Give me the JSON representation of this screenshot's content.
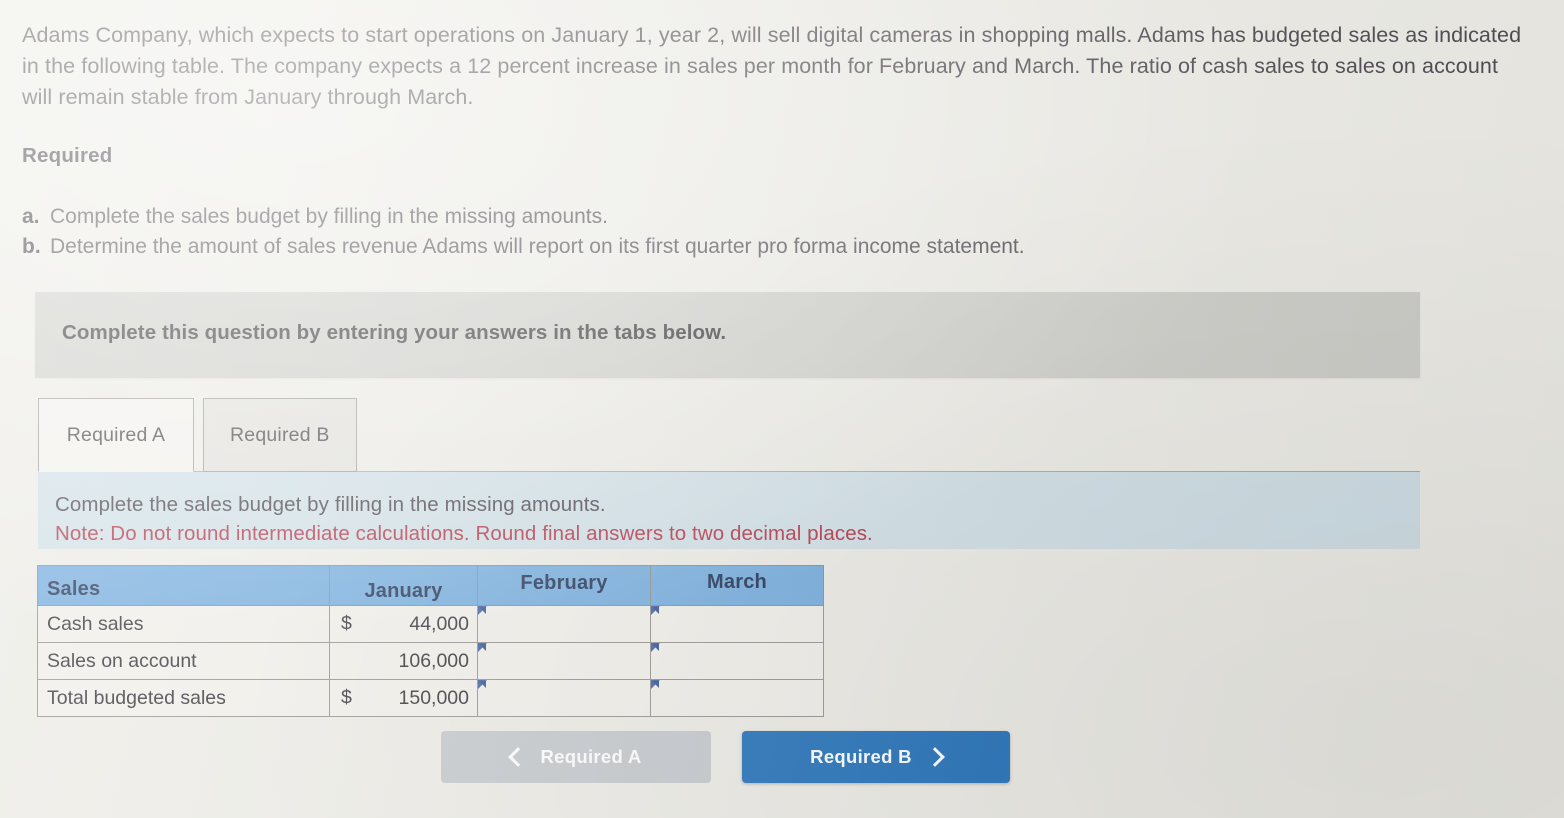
{
  "question": {
    "stem": "Adams Company, which expects to start operations on January 1, year 2, will sell digital cameras in shopping malls. Adams has budgeted sales as indicated in the following table. The company expects a 12 percent increase in sales per month for February and March. The ratio of cash sales to sales on account will remain stable from January through March.",
    "required_heading": "Required",
    "requirements": [
      {
        "marker": "a.",
        "text": "Complete the sales budget by filling in the missing amounts."
      },
      {
        "marker": "b.",
        "text": "Determine the amount of sales revenue Adams will report on its first quarter pro forma income statement."
      }
    ]
  },
  "banner": {
    "text": "Complete this question by entering your answers in the tabs below."
  },
  "tabs": [
    {
      "label": "Required A",
      "active": true
    },
    {
      "label": "Required B",
      "active": false
    }
  ],
  "instructions": {
    "line1": "Complete the sales budget by filling in the missing amounts.",
    "line2": "Note: Do not round intermediate calculations. Round final answers to two decimal places."
  },
  "table": {
    "headers": [
      "Sales",
      "January",
      "February",
      "March"
    ],
    "rows": [
      {
        "label": "Cash sales",
        "january_currency": "$",
        "january_value": "44,000",
        "february_value": "",
        "march_value": ""
      },
      {
        "label": "Sales on account",
        "january_currency": "",
        "january_value": "106,000",
        "february_value": "",
        "march_value": ""
      },
      {
        "label": "Total budgeted sales",
        "january_currency": "$",
        "january_value": "150,000",
        "february_value": "",
        "march_value": ""
      }
    ]
  },
  "navigation": {
    "prev_label": "Required A",
    "next_label": "Required B",
    "prev_icon": "chevron-left-icon",
    "next_icon": "chevron-right-icon"
  },
  "colors": {
    "page_background": "#ecebe5",
    "banner_background": "#ccccc7",
    "instruction_background": "#cfdfe6",
    "note_text": "#b02a3c",
    "table_header": "#70aadd",
    "input_border": "#2b4a86",
    "primary_button": "#1b6cb7",
    "disabled_button": "#c3c7cb"
  }
}
